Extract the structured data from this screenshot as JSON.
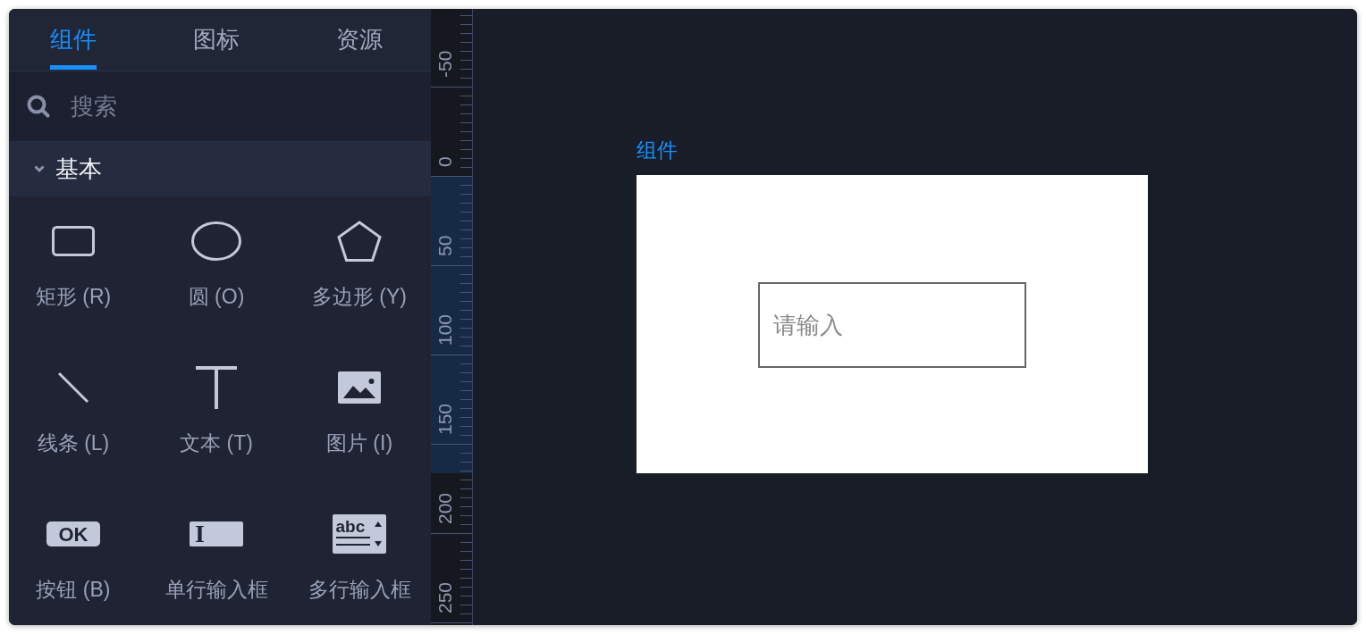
{
  "panel": {
    "tabs": [
      {
        "label": "组件",
        "selected": true
      },
      {
        "label": "图标",
        "selected": false
      },
      {
        "label": "资源",
        "selected": false
      }
    ],
    "search": {
      "placeholder": "搜索"
    },
    "section": {
      "title": "基本",
      "expanded": true,
      "items": [
        {
          "kind": "rectangle",
          "label": "矩形 (R)"
        },
        {
          "kind": "ellipse",
          "label": "圆 (O)"
        },
        {
          "kind": "polygon",
          "label": "多边形 (Y)"
        },
        {
          "kind": "line",
          "label": "线条 (L)"
        },
        {
          "kind": "text",
          "label": "文本 (T)"
        },
        {
          "kind": "image",
          "label": "图片 (I)"
        },
        {
          "kind": "button",
          "icon_text": "OK",
          "label": "按钮 (B)"
        },
        {
          "kind": "input",
          "icon_text": "I",
          "label": "单行输入框"
        },
        {
          "kind": "textarea",
          "icon_text": "abc",
          "label": "多行输入框"
        }
      ]
    }
  },
  "ruler": {
    "labels": [
      "-50",
      "0",
      "50",
      "100",
      "150",
      "200",
      "250"
    ]
  },
  "canvas": {
    "artboard": {
      "title": "组件",
      "field": {
        "placeholder": "请输入"
      }
    }
  }
}
